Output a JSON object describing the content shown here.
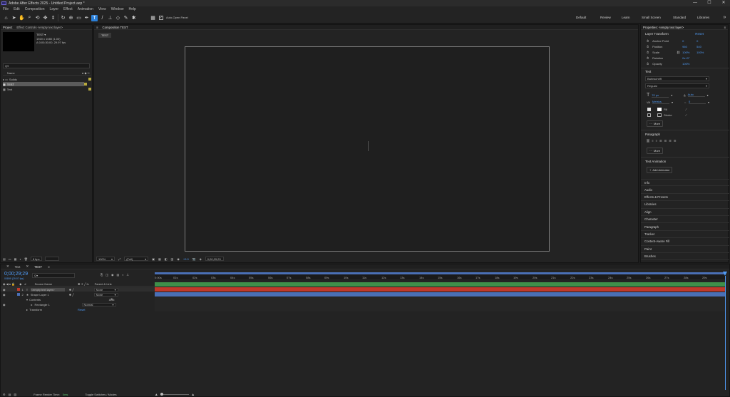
{
  "app": {
    "title": "Adobe After Effects 2025 - Untitled Project.aep *",
    "window_controls": [
      "—",
      "☐",
      "✕"
    ]
  },
  "menu": [
    "File",
    "Edit",
    "Composition",
    "Layer",
    "Effect",
    "Animation",
    "View",
    "Window",
    "Help"
  ],
  "toolbar": {
    "auto_open_panel": "Auto-Open Panel",
    "workspaces": [
      "Default",
      "Review",
      "Learn",
      "Small Screen",
      "Standard",
      "Libraries"
    ]
  },
  "project": {
    "tabs": [
      "Project",
      "Effect Controls <empty text layer>"
    ],
    "selected_name": "TEST ▾",
    "meta1": "1920 x 1080 (1.00)",
    "meta2": "Δ 0;00;30;00, 29.97 fps",
    "search_placeholder": "Q▾",
    "col_name": "Name",
    "items": [
      "Solids",
      "TEST",
      "Text"
    ],
    "bpc": "8 bpc"
  },
  "comp": {
    "tab": "Composition TEST",
    "subtab": "TEST",
    "zoom": "100%",
    "resolution": "(Full)",
    "timecode": "0;00;29;29"
  },
  "properties": {
    "title": "Properties: <empty text layer>",
    "layer_transform": "Layer Transform",
    "reset": "Reset",
    "rows": [
      {
        "label": "Anchor Point",
        "v1": "0",
        "v2": "0"
      },
      {
        "label": "Position",
        "v1": "960",
        "v2": "540"
      },
      {
        "label": "Scale",
        "v1": "100%",
        "v2": "100%"
      },
      {
        "label": "Rotation",
        "v1": "0x+0°",
        "v2": ""
      },
      {
        "label": "Opacity",
        "v1": "100%",
        "v2": ""
      }
    ],
    "text_hdr": "Text",
    "font": "Bahnschrift",
    "style": "Regular",
    "size": "70 px",
    "leading": "Auto",
    "kerning": "Metrics",
    "tracking": "0",
    "fill": "Fill",
    "stroke": "Stroke",
    "more": "More",
    "paragraph_hdr": "Paragraph",
    "text_anim_hdr": "Text Animation",
    "add_animator": "Add Animator",
    "accordions": [
      "Info",
      "Audio",
      "Effects & Presets",
      "Libraries",
      "Align",
      "Character",
      "Paragraph",
      "Tracker",
      "Content-Aware Fill",
      "Paint",
      "Brushes"
    ]
  },
  "timeline": {
    "tabs": [
      "Text",
      "TEST"
    ],
    "timecode": "0;00;29;29",
    "frames": "00899 (29.97 fps)",
    "search_placeholder": "Q▾",
    "col_source": "Source Name",
    "col_parent": "Parent & Link",
    "layers": [
      {
        "num": "1",
        "name": "<empty text layer>",
        "parent": "None",
        "color": "#c0392b"
      },
      {
        "num": "2",
        "name": "Shape Layer 1",
        "parent": "None",
        "color": "#4a6fb5"
      }
    ],
    "contents": "Contents",
    "add": "Add:",
    "rectangle": "Rectangle 1",
    "blend": "Normal",
    "transform": "Transform",
    "reset": "Reset",
    "ruler": [
      "0:00s",
      "01s",
      "02s",
      "03s",
      "04s",
      "05s",
      "06s",
      "07s",
      "08s",
      "09s",
      "10s",
      "11s",
      "12s",
      "13s",
      "14s",
      "15s",
      "16s",
      "17s",
      "18s",
      "19s",
      "20s",
      "21s",
      "22s",
      "23s",
      "24s",
      "25s",
      "26s",
      "27s",
      "28s",
      "29s"
    ],
    "frame_render": "Frame Render Time:",
    "frame_render_val": "0ms",
    "toggle": "Toggle Switches / Modes"
  },
  "colors": {
    "accent": "#2a7fd8",
    "layer1": "#c0392b",
    "layer2": "#4a6fb5",
    "track_green": "#3f8f4a"
  }
}
